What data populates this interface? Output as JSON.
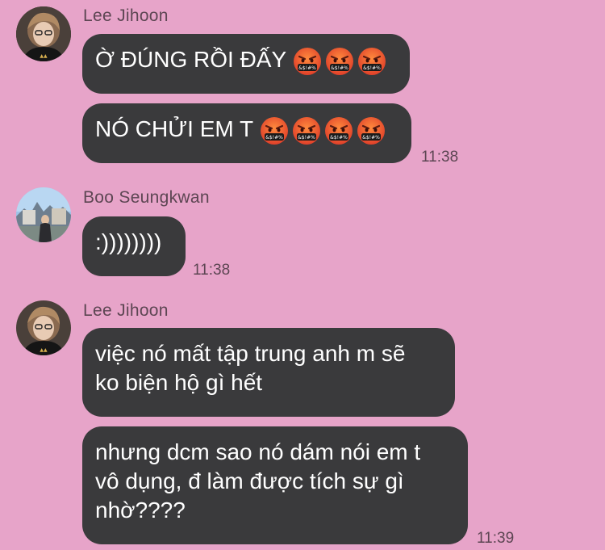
{
  "colors": {
    "background": "#e7a4c9",
    "bubble": "#3a3a3c",
    "bubble_text": "#ffffff",
    "meta_text": "#5d4653"
  },
  "groups": [
    {
      "sender": "Lee Jihoon",
      "avatar_icon": "profile-photo-lee-jihoon",
      "messages": [
        {
          "text": "Ờ ĐÚNG RỒI ĐẤY",
          "emoji_icon": "face-with-symbols-on-mouth-emoji",
          "emoji_count": 3
        },
        {
          "text": "NÓ CHỬI EM T",
          "emoji_icon": "face-with-symbols-on-mouth-emoji",
          "emoji_count": 4
        }
      ],
      "time": "11:38"
    },
    {
      "sender": "Boo Seungkwan",
      "avatar_icon": "profile-photo-boo-seungkwan",
      "messages": [
        {
          "text": ":))))))))"
        }
      ],
      "time": "11:38"
    },
    {
      "sender": "Lee Jihoon",
      "avatar_icon": "profile-photo-lee-jihoon",
      "messages": [
        {
          "lines": [
            "việc nó mất tập trung anh m sẽ",
            "ko biện hộ gì hết"
          ]
        },
        {
          "lines": [
            "nhưng dcm sao nó dám nói em t",
            "vô dụng, đ làm được tích sự gì",
            "nhờ????"
          ]
        }
      ],
      "time": "11:39"
    }
  ]
}
